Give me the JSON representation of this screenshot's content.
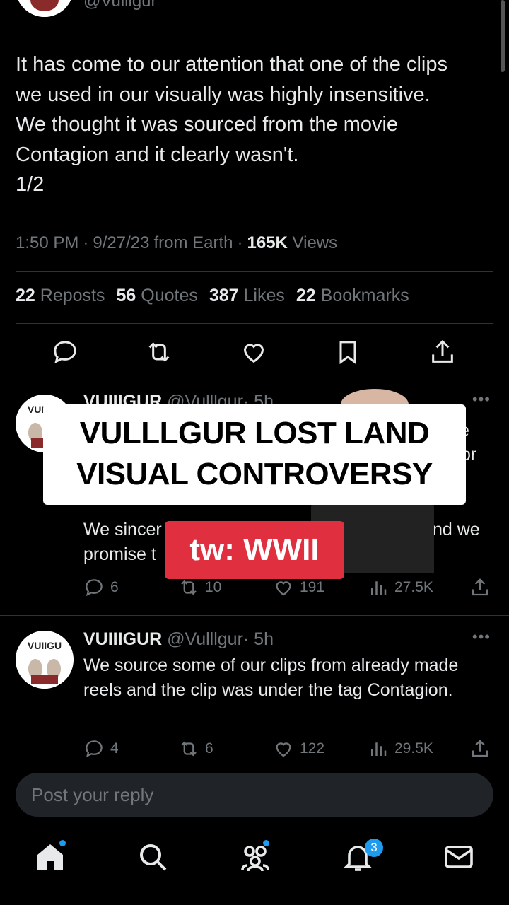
{
  "top_tweet": {
    "handle": "@Vulllgur",
    "text": "It has come to our attention that one of the clips\nwe used in our visually was highly insensitive.\nWe thought it was sourced from the movie\nContagion and it clearly wasn't.\n1/2",
    "time": "1:50 PM",
    "date": "9/27/23",
    "source": "from Earth",
    "views_count": "165K",
    "views_label": "Views",
    "stats": [
      {
        "count": "22",
        "label": "Reposts"
      },
      {
        "count": "56",
        "label": "Quotes"
      },
      {
        "count": "387",
        "label": "Likes"
      },
      {
        "count": "22",
        "label": "Bookmarks"
      }
    ]
  },
  "replies": [
    {
      "name": "VUIIIGUR",
      "handle": "@Vulllgur",
      "age": "· 5h",
      "line_top_right_1": "e",
      "line_top_right_2": "or",
      "body_line_a_left": "We sincer",
      "body_line_a_right": "nd we",
      "body_line_b_left": "promise t",
      "comments": "6",
      "reposts": "10",
      "likes": "191",
      "views": "27.5K"
    },
    {
      "name": "VUIIIGUR",
      "handle": "@Vulllgur",
      "age": "· 5h",
      "body": "We source some of our clips from already made reels and the clip was under the tag Contagion.",
      "comments": "4",
      "reposts": "6",
      "likes": "122",
      "views": "29.5K"
    }
  ],
  "overlay": {
    "caption_line1": "VULLLGUR LOST LAND",
    "caption_line2": "VISUAL CONTROVERSY",
    "warning": "tw: WWII"
  },
  "reply_box": {
    "placeholder": "Post your reply"
  },
  "notifications_badge": "3",
  "icons": [
    "reply-icon",
    "repost-icon",
    "like-icon",
    "bookmark-icon",
    "share-icon",
    "home-icon",
    "search-icon",
    "communities-icon",
    "notifications-icon",
    "messages-icon"
  ],
  "colors": {
    "background": "#000000",
    "text": "#e7e9ea",
    "muted": "#71767b",
    "accent": "#1d9bf0",
    "warning_red": "#e0303f"
  }
}
